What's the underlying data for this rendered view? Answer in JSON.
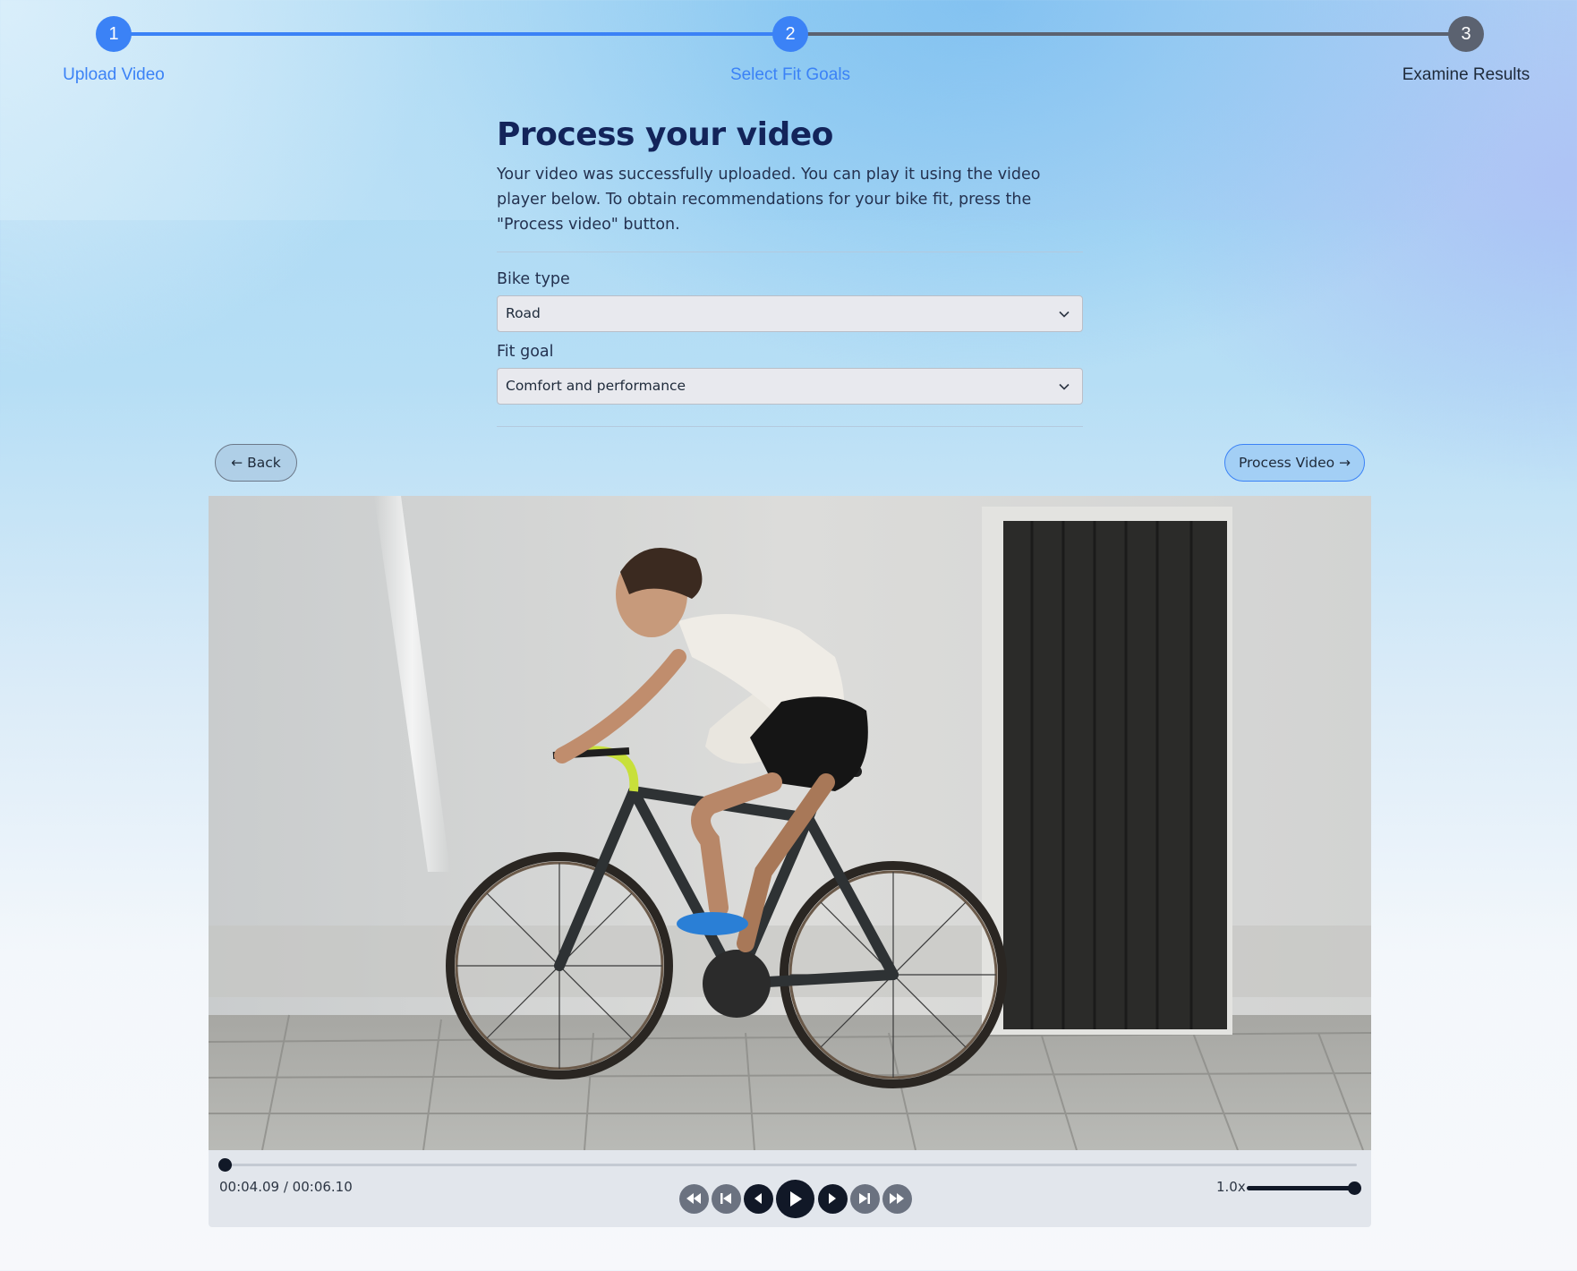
{
  "stepper": {
    "steps": [
      {
        "number": "1",
        "label": "Upload Video",
        "state": "complete"
      },
      {
        "number": "2",
        "label": "Select Fit Goals",
        "state": "current"
      },
      {
        "number": "3",
        "label": "Examine Results",
        "state": "upcoming"
      }
    ]
  },
  "main": {
    "title": "Process your video",
    "description": "Your video was successfully uploaded. You can play it using the video player below. To obtain recommendations for your bike fit, press the \"Process video\" button.",
    "bike_type": {
      "label": "Bike type",
      "value": "Road"
    },
    "fit_goal": {
      "label": "Fit goal",
      "value": "Comfort and performance"
    }
  },
  "actions": {
    "back_label": "← Back",
    "process_label": "Process Video →"
  },
  "player": {
    "time_display": "00:04.09 / 00:06.10",
    "progress_fraction": 0.0,
    "speed_label": "1.0x",
    "speed_fraction": 1.0,
    "buttons": [
      "fast-rewind-icon",
      "skip-back-icon",
      "step-back-icon",
      "play-icon",
      "step-forward-icon",
      "skip-forward-icon",
      "fast-forward-icon"
    ]
  },
  "colors": {
    "accent": "#3b82f6",
    "inactive": "#5b6270",
    "title": "#13245a"
  }
}
